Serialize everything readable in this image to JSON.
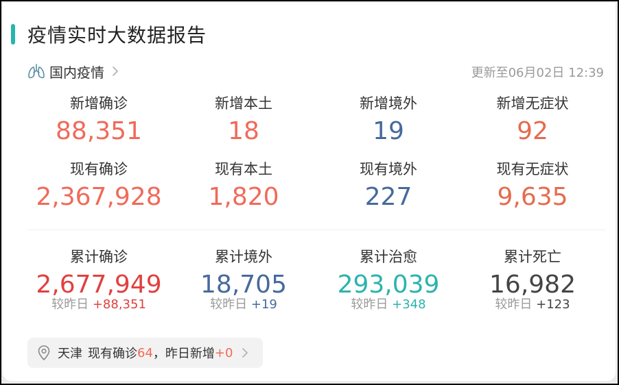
{
  "header": {
    "title": "疫情实时大数据报告"
  },
  "region": {
    "label": "国内疫情",
    "icon": "lungs-icon",
    "chevron": "chevron-right-icon",
    "updated": "更新至06月02日 12:39"
  },
  "colors": {
    "accent": "#26b5b0",
    "salmon": "#f06a5a",
    "blue": "#466a9b",
    "orange": "#e56b4e",
    "red": "#e0403f",
    "teal": "#2bb3ad",
    "dark": "#444444",
    "gray": "#9a9a9a"
  },
  "new_stats": [
    {
      "label": "新增确诊",
      "value": "88,351"
    },
    {
      "label": "新增本土",
      "value": "18"
    },
    {
      "label": "新增境外",
      "value": "19"
    },
    {
      "label": "新增无症状",
      "value": "92"
    }
  ],
  "current_stats": [
    {
      "label": "现有确诊",
      "value": "2,367,928"
    },
    {
      "label": "现有本土",
      "value": "1,820"
    },
    {
      "label": "现有境外",
      "value": "227"
    },
    {
      "label": "现有无症状",
      "value": "9,635"
    }
  ],
  "total_stats": [
    {
      "label": "累计确诊",
      "value": "2,677,949",
      "delta_prefix": "较昨日",
      "delta": "+88,351"
    },
    {
      "label": "累计境外",
      "value": "18,705",
      "delta_prefix": "较昨日",
      "delta": "+19"
    },
    {
      "label": "累计治愈",
      "value": "293,039",
      "delta_prefix": "较昨日",
      "delta": "+348"
    },
    {
      "label": "累计死亡",
      "value": "16,982",
      "delta_prefix": "较昨日",
      "delta": "+123"
    }
  ],
  "local": {
    "icon": "location-pin-icon",
    "city": "天津",
    "current_label": "现有确诊",
    "current_value": "64",
    "new_label": "，昨日新增",
    "new_value": "+0"
  }
}
